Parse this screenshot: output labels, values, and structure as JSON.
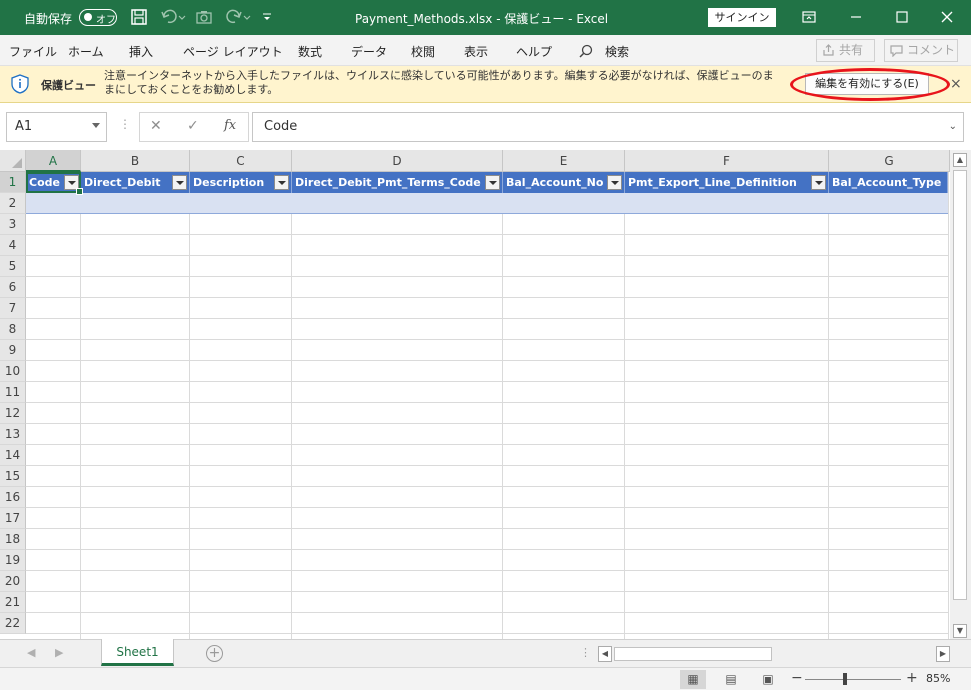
{
  "titlebar": {
    "autosave_label": "自動保存",
    "autosave_state": "オフ",
    "title": "Payment_Methods.xlsx  -  保護ビュー  -  Excel",
    "signin": "サインイン",
    "accent": "#217346"
  },
  "menu": {
    "items": [
      "ファイル",
      "ホーム",
      "挿入",
      "ページ レイアウト",
      "数式",
      "データ",
      "校閲",
      "表示",
      "ヘルプ"
    ],
    "search": "検索",
    "share": "共有",
    "comment": "コメント"
  },
  "protected_view": {
    "title": "保護ビュー",
    "message": "注意ーインターネットから入手したファイルは、ウイルスに感染している可能性があります。編集する必要がなければ、保護ビューのままにしておくことをお勧めします。",
    "enable_button": "編集を有効にする(E)",
    "close": "×"
  },
  "formula_bar": {
    "name_box": "A1",
    "cancel": "✕",
    "enter": "✓",
    "fx": "fx",
    "content": "Code"
  },
  "grid": {
    "selected_column": "A",
    "columns": [
      "A",
      "B",
      "C",
      "D",
      "E",
      "F",
      "G"
    ],
    "rows": [
      "1",
      "2",
      "3",
      "4",
      "5",
      "6",
      "7",
      "8",
      "9",
      "10",
      "11",
      "12",
      "13",
      "14",
      "15",
      "16",
      "17",
      "18",
      "19",
      "20",
      "21",
      "22"
    ],
    "table_headers": [
      "Code",
      "Direct_Debit",
      "Description",
      "Direct_Debit_Pmt_Terms_Code",
      "Bal_Account_No",
      "Pmt_Export_Line_Definition",
      "Bal_Account_Type"
    ],
    "header_color": "#4472c4",
    "band_color": "#d9e1f2"
  },
  "sheets": {
    "tabs": [
      "Sheet1"
    ],
    "add": "+"
  },
  "status": {
    "zoom": "85%",
    "zoom_minus": "−",
    "zoom_plus": "+"
  }
}
